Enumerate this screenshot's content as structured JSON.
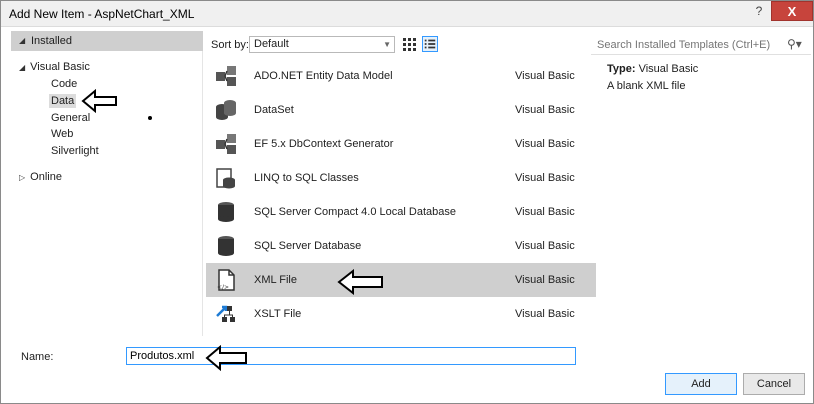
{
  "window": {
    "title": "Add New Item - AspNetChart_XML",
    "help": "?",
    "close": "X"
  },
  "tree": {
    "installed": "Installed",
    "visual_basic": "Visual Basic",
    "children": [
      "Code",
      "Data",
      "General",
      "Web",
      "Silverlight"
    ],
    "online": "Online"
  },
  "toolbar": {
    "sort_by_label": "Sort by:",
    "sort_value": "Default"
  },
  "search": {
    "placeholder": "Search Installed Templates (Ctrl+E)"
  },
  "templates": [
    {
      "name": "ADO.NET Entity Data Model",
      "type": "Visual Basic",
      "icon": "entity-model-icon"
    },
    {
      "name": "DataSet",
      "type": "Visual Basic",
      "icon": "dataset-icon"
    },
    {
      "name": "EF 5.x DbContext Generator",
      "type": "Visual Basic",
      "icon": "dbcontext-generator-icon"
    },
    {
      "name": "LINQ to SQL Classes",
      "type": "Visual Basic",
      "icon": "linq-to-sql-icon"
    },
    {
      "name": "SQL Server Compact 4.0 Local Database",
      "type": "Visual Basic",
      "icon": "database-icon"
    },
    {
      "name": "SQL Server Database",
      "type": "Visual Basic",
      "icon": "database-icon"
    },
    {
      "name": "XML File",
      "type": "Visual Basic",
      "icon": "xml-file-icon"
    },
    {
      "name": "XSLT File",
      "type": "Visual Basic",
      "icon": "xslt-file-icon"
    }
  ],
  "description": {
    "type_label": "Type:",
    "type_value": "Visual Basic",
    "text": "A blank XML file"
  },
  "name_field": {
    "label": "Name:",
    "value": "Produtos.xml"
  },
  "buttons": {
    "add": "Add",
    "cancel": "Cancel"
  }
}
